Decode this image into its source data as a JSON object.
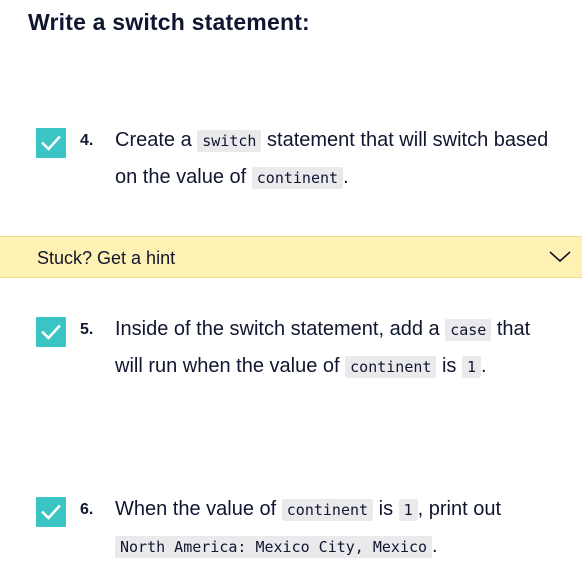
{
  "heading": "Write a switch statement:",
  "tasks": [
    {
      "number": "4.",
      "text_1": "Create a ",
      "code_1": "switch",
      "text_2": " statement that will switch based on the value of ",
      "code_2": "continent",
      "text_3": "."
    },
    {
      "number": "5.",
      "text_1": "Inside of the switch statement, add a ",
      "code_1": "case",
      "text_2": " that will run when the value of ",
      "code_2": "continent",
      "text_3": " is ",
      "code_3": "1",
      "text_4": "."
    },
    {
      "number": "6.",
      "text_1": "When the value of ",
      "code_1": "continent",
      "text_2": " is ",
      "code_2": "1",
      "text_3": ", print out ",
      "code_3": "North America: Mexico City, Mexico",
      "text_4": "."
    }
  ],
  "hint": {
    "label": "Stuck? Get a hint"
  },
  "colors": {
    "checkbox": "#3bc4c4",
    "hint_background": "#fff0b3",
    "text": "#10162f"
  }
}
